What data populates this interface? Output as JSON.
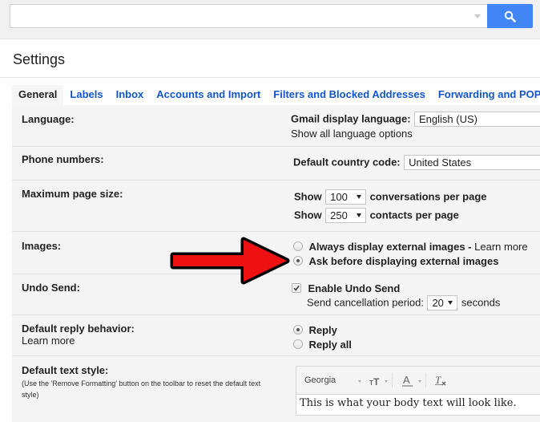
{
  "search": {
    "value": "",
    "placeholder": "",
    "button_icon": "search-icon"
  },
  "page": {
    "title": "Settings"
  },
  "tabs": [
    {
      "label": "General",
      "active": true
    },
    {
      "label": "Labels"
    },
    {
      "label": "Inbox"
    },
    {
      "label": "Accounts and Import"
    },
    {
      "label": "Filters and Blocked Addresses"
    },
    {
      "label": "Forwarding and POP/IMAP"
    }
  ],
  "settings": {
    "language": {
      "label": "Language:",
      "field_label": "Gmail display language:",
      "value": "English (US)",
      "link": "Show all language options"
    },
    "phone": {
      "label": "Phone numbers:",
      "field_label": "Default country code:",
      "value": "United States"
    },
    "page_size": {
      "label": "Maximum page size:",
      "show_label": "Show",
      "conversations_value": "100",
      "conversations_suffix": "conversations per page",
      "contacts_value": "250",
      "contacts_suffix": "contacts per page"
    },
    "images": {
      "label": "Images:",
      "option_always": "Always display external images",
      "separator": " - ",
      "learn_more": "Learn more",
      "option_ask": "Ask before displaying external images",
      "selected": "ask"
    },
    "undo_send": {
      "label": "Undo Send:",
      "checkbox_label": "Enable Undo Send",
      "checked": true,
      "period_label": "Send cancellation period:",
      "period_value": "20",
      "period_suffix": "seconds"
    },
    "reply": {
      "label": "Default reply behavior:",
      "learn_more": "Learn more",
      "option_reply": "Reply",
      "option_reply_all": "Reply all",
      "selected": "reply"
    },
    "text_style": {
      "label": "Default text style:",
      "hint": "(Use the 'Remove Formatting' button on the toolbar to reset the default text style)",
      "font": "Georgia",
      "size_icon": "text-size-icon",
      "color_icon": "text-color-icon",
      "remove_format_icon": "remove-formatting-icon",
      "preview": "This is what your body text will look like."
    }
  },
  "annotation": {
    "arrow_color": "#ee1111",
    "points_to": "Ask before displaying external images"
  }
}
